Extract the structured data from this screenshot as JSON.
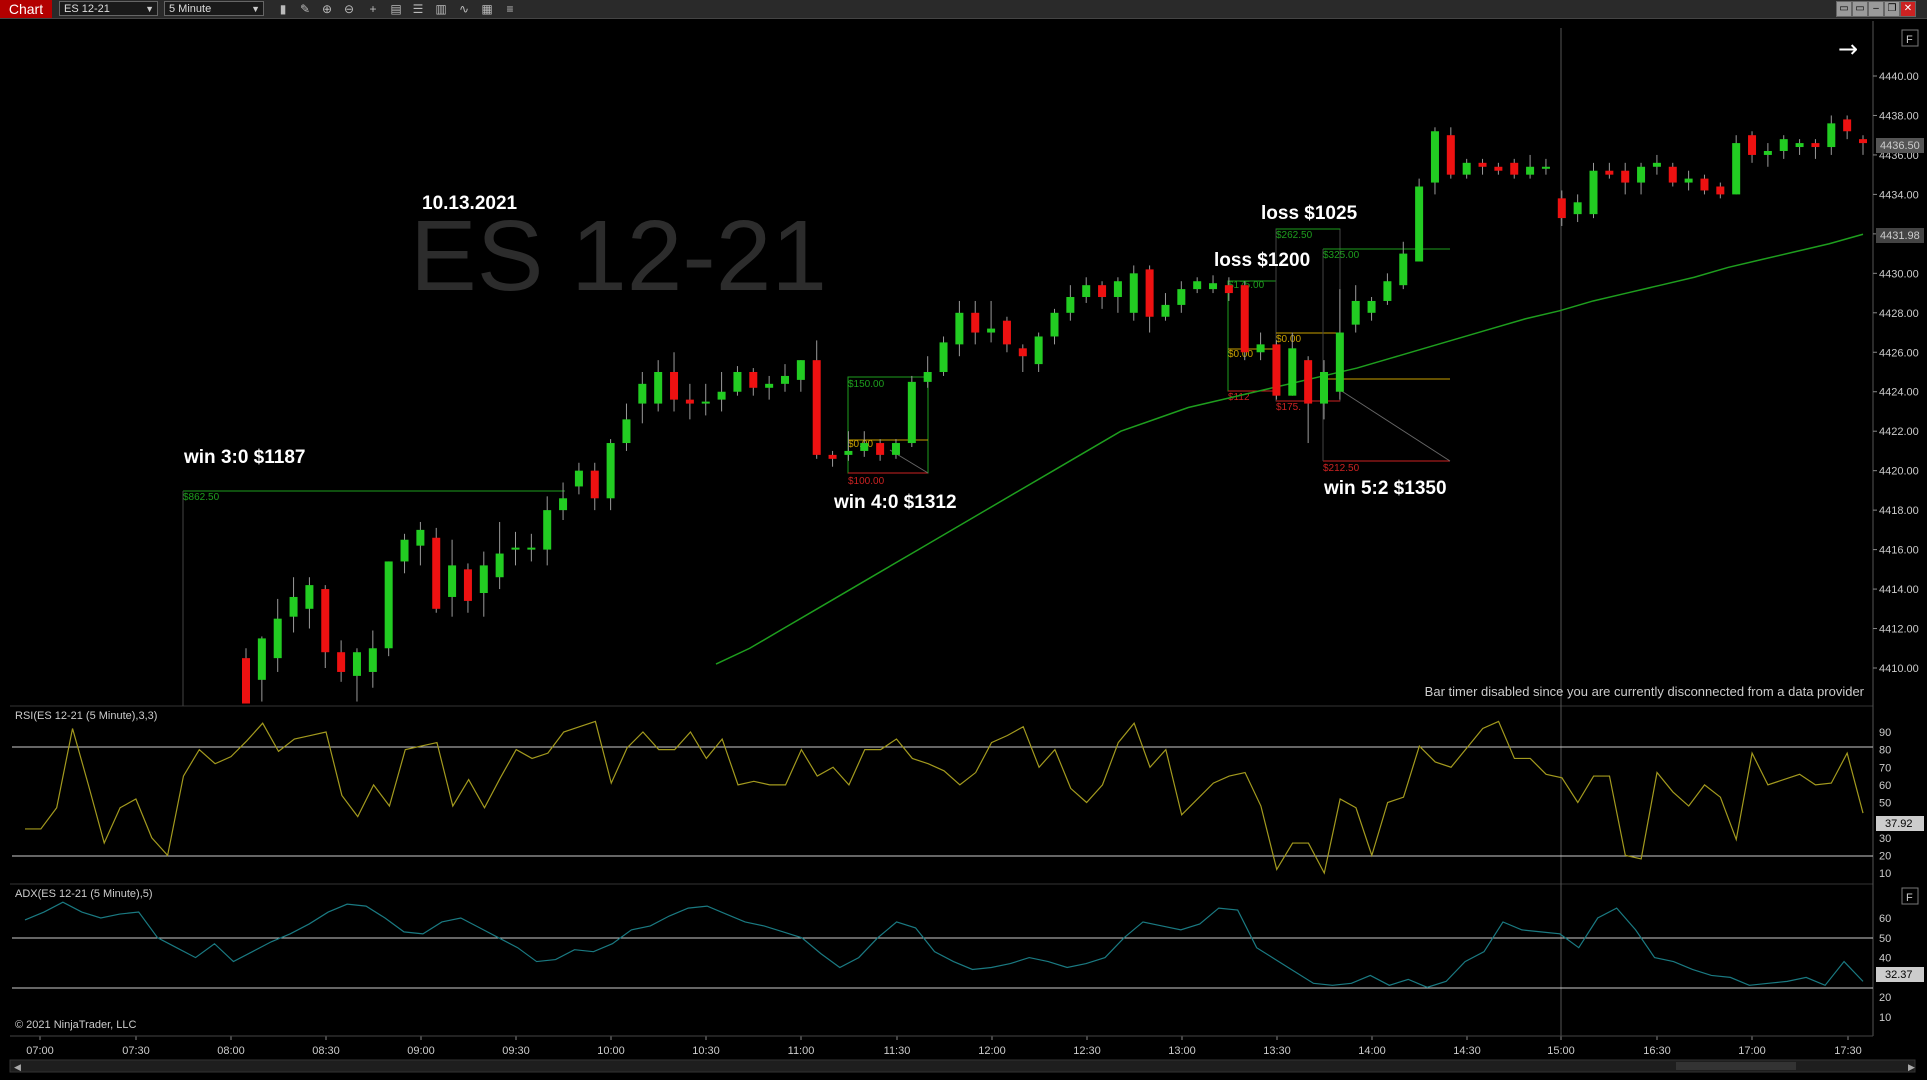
{
  "toolbar": {
    "chart_tab": "Chart",
    "instrument": "ES 12-21",
    "interval": "5 Minute",
    "tool_icons": [
      "bars-icon",
      "pencil-icon",
      "zoom-in-icon",
      "zoom-out-icon",
      "crosshair-icon",
      "properties-icon",
      "data-box-icon",
      "chart-style-icon",
      "indicators-icon",
      "strategies-icon",
      "list-icon"
    ],
    "window_buttons": [
      "tile-icon",
      "tile2-icon",
      "minimize-icon",
      "restore-icon",
      "close-icon"
    ]
  },
  "chart": {
    "watermark": "ES 12-21",
    "date": "10.13.2021",
    "bar_timer_msg": "Bar timer disabled since you are currently disconnected from a data provider",
    "copyright": "© 2021 NinjaTrader, LLC",
    "price_ticks": [
      "4440.00",
      "4438.00",
      "4436.00",
      "4434.00",
      "4432.00",
      "4430.00",
      "4428.00",
      "4426.00",
      "4424.00",
      "4422.00",
      "4420.00",
      "4418.00",
      "4416.00",
      "4414.00",
      "4412.00",
      "4410.00"
    ],
    "current_price": "4436.50",
    "ma_price": "4431.98",
    "time_ticks": [
      "07:00",
      "07:30",
      "08:00",
      "08:30",
      "09:00",
      "09:30",
      "10:00",
      "10:30",
      "11:00",
      "11:30",
      "12:00",
      "12:30",
      "13:00",
      "13:30",
      "14:00",
      "14:30",
      "15:00",
      "16:30",
      "17:00",
      "17:30"
    ],
    "annotations": [
      {
        "text": "win 3:0 $1187"
      },
      {
        "text": "win 4:0 $1312"
      },
      {
        "text": "loss $1200"
      },
      {
        "text": "loss $1025"
      },
      {
        "text": "win 5:2 $1350"
      }
    ],
    "trade_labels": [
      "$862.50",
      "$150.00",
      "$0.00",
      "$100.00",
      "$175.00",
      "$0.00",
      "$112",
      "$175.",
      "$262.50",
      "$325.00",
      "$0.00",
      "$212.50"
    ],
    "colors": {
      "up": "#22cc22",
      "down": "#ee1111",
      "ma": "#1e9e1e",
      "rsi": "#a39a1e",
      "adx": "#1a7a82"
    }
  },
  "rsi": {
    "title": "RSI(ES 12-21 (5 Minute),3,3)",
    "ticks": [
      "90",
      "80",
      "70",
      "60",
      "50",
      "40",
      "30",
      "20",
      "10"
    ],
    "value": "37.92"
  },
  "adx": {
    "title": "ADX(ES 12-21 (5 Minute),5)",
    "ticks": [
      "60",
      "50",
      "40",
      "30",
      "20",
      "10"
    ],
    "value": "32.37"
  },
  "chart_data": {
    "type": "candlestick",
    "instrument": "ES 12-21",
    "interval": "5 Minute",
    "ylim": [
      4409,
      4442
    ],
    "candles": [
      [
        4410.5,
        4408.2,
        4408.8,
        4411.0
      ],
      [
        4409.4,
        4411.5,
        4408.3,
        4411.6
      ],
      [
        4410.5,
        4412.5,
        4409.8,
        4413.5
      ],
      [
        4412.6,
        4413.6,
        4411.8,
        4414.6
      ],
      [
        4413.0,
        4414.2,
        4412.0,
        4414.6
      ],
      [
        4414.0,
        4410.8,
        4410.0,
        4414.2
      ],
      [
        4410.8,
        4409.8,
        4409.3,
        4411.4
      ],
      [
        4409.6,
        4410.8,
        4408.3,
        4411.0
      ],
      [
        4409.8,
        4411.0,
        4409.0,
        4411.9
      ],
      [
        4411.0,
        4415.4,
        4410.6,
        4415.4
      ],
      [
        4415.4,
        4416.5,
        4414.8,
        4416.8
      ],
      [
        4416.2,
        4417.0,
        4415.2,
        4417.4
      ],
      [
        4416.6,
        4413.0,
        4412.8,
        4417.1
      ],
      [
        4413.6,
        4415.2,
        4412.6,
        4416.5
      ],
      [
        4415.0,
        4413.4,
        4412.8,
        4415.3
      ],
      [
        4413.8,
        4415.2,
        4412.6,
        4415.9
      ],
      [
        4414.6,
        4415.8,
        4414.0,
        4417.4
      ],
      [
        4416.0,
        4416.1,
        4415.2,
        4416.9
      ],
      [
        4416.0,
        4416.1,
        4415.4,
        4416.8
      ],
      [
        4416.0,
        4418.0,
        4415.2,
        4418.7
      ],
      [
        4418.0,
        4418.6,
        4417.5,
        4419.4
      ],
      [
        4419.2,
        4420.0,
        4418.8,
        4420.4
      ],
      [
        4420.0,
        4418.6,
        4418.0,
        4420.4
      ],
      [
        4418.6,
        4421.4,
        4418.0,
        4421.6
      ],
      [
        4421.4,
        4422.6,
        4421.0,
        4423.4
      ],
      [
        4423.4,
        4424.4,
        4422.4,
        4425.0
      ],
      [
        4423.4,
        4425.0,
        4423.0,
        4425.6
      ],
      [
        4425.0,
        4423.6,
        4423.0,
        4426.0
      ],
      [
        4423.6,
        4423.4,
        4422.6,
        4424.4
      ],
      [
        4423.4,
        4423.5,
        4422.8,
        4424.4
      ],
      [
        4423.6,
        4424.0,
        4423.0,
        4425.0
      ],
      [
        4424.0,
        4425.0,
        4423.8,
        4425.3
      ],
      [
        4425.0,
        4424.2,
        4423.8,
        4425.2
      ],
      [
        4424.2,
        4424.4,
        4423.6,
        4424.8
      ],
      [
        4424.4,
        4424.8,
        4424.0,
        4425.4
      ],
      [
        4424.6,
        4425.6,
        4424.0,
        4425.6
      ],
      [
        4425.6,
        4420.8,
        4420.6,
        4426.6
      ],
      [
        4420.8,
        4420.6,
        4420.2,
        4421.0
      ],
      [
        4420.8,
        4421.0,
        4420.5,
        4422.0
      ],
      [
        4421.0,
        4421.4,
        4420.7,
        4422.0
      ],
      [
        4421.4,
        4420.8,
        4420.5,
        4421.6
      ],
      [
        4420.8,
        4421.4,
        4420.6,
        4421.6
      ],
      [
        4421.4,
        4424.5,
        4421.2,
        4424.8
      ],
      [
        4424.5,
        4425.0,
        4424.2,
        4425.8
      ],
      [
        4425.0,
        4426.5,
        4424.8,
        4426.8
      ],
      [
        4426.4,
        4428.0,
        4425.8,
        4428.6
      ],
      [
        4428.0,
        4427.0,
        4426.4,
        4428.6
      ],
      [
        4427.0,
        4427.2,
        4426.5,
        4428.6
      ],
      [
        4427.6,
        4426.4,
        4426.0,
        4427.8
      ],
      [
        4426.2,
        4425.8,
        4425.0,
        4426.4
      ],
      [
        4425.4,
        4426.8,
        4425.0,
        4427.0
      ],
      [
        4426.8,
        4428.0,
        4426.4,
        4428.2
      ],
      [
        4428.0,
        4428.8,
        4427.6,
        4429.4
      ],
      [
        4428.8,
        4429.4,
        4428.5,
        4429.8
      ],
      [
        4429.4,
        4428.8,
        4428.2,
        4429.6
      ],
      [
        4428.8,
        4429.6,
        4428.0,
        4429.8
      ],
      [
        4428.0,
        4430.0,
        4427.6,
        4430.4
      ],
      [
        4430.2,
        4427.8,
        4427.0,
        4430.4
      ],
      [
        4427.8,
        4428.4,
        4427.6,
        4429.0
      ],
      [
        4428.4,
        4429.2,
        4428.0,
        4429.6
      ],
      [
        4429.2,
        4429.6,
        4429.0,
        4429.8
      ],
      [
        4429.2,
        4429.5,
        4429.0,
        4429.9
      ],
      [
        4429.4,
        4429.0,
        4428.6,
        4429.8
      ],
      [
        4429.4,
        4426.0,
        4425.6,
        4429.6
      ],
      [
        4426.0,
        4426.4,
        4425.6,
        4427.0
      ],
      [
        4426.4,
        4423.8,
        4423.6,
        4426.6
      ],
      [
        4423.8,
        4426.2,
        4423.8,
        4427.0
      ],
      [
        4425.6,
        4423.4,
        4421.4,
        4425.8
      ],
      [
        4423.4,
        4425.0,
        4422.6,
        4425.6
      ],
      [
        4424.0,
        4427.0,
        4423.6,
        4429.2
      ],
      [
        4427.4,
        4428.6,
        4427.0,
        4429.4
      ],
      [
        4428.0,
        4428.6,
        4427.6,
        4428.8
      ],
      [
        4428.6,
        4429.6,
        4428.4,
        4430.0
      ],
      [
        4429.4,
        4431.0,
        4429.2,
        4431.6
      ],
      [
        4430.6,
        4434.4,
        4430.6,
        4434.8
      ],
      [
        4434.6,
        4437.2,
        4434.0,
        4437.4
      ],
      [
        4437.0,
        4435.0,
        4434.8,
        4437.4
      ],
      [
        4435.0,
        4435.6,
        4434.8,
        4435.8
      ],
      [
        4435.6,
        4435.4,
        4435.0,
        4435.8
      ],
      [
        4435.4,
        4435.2,
        4435.0,
        4435.6
      ],
      [
        4435.6,
        4435.0,
        4434.8,
        4435.8
      ],
      [
        4435.0,
        4435.4,
        4434.8,
        4436.0
      ],
      [
        4435.4,
        4435.4,
        4435.0,
        4435.8
      ],
      [
        4433.8,
        4432.8,
        4432.4,
        4434.2
      ],
      [
        4433.0,
        4433.6,
        4432.6,
        4434.0
      ],
      [
        4433.0,
        4435.2,
        4432.8,
        4435.6
      ],
      [
        4435.2,
        4435.0,
        4434.8,
        4435.6
      ],
      [
        4435.2,
        4434.6,
        4434.0,
        4435.6
      ],
      [
        4434.6,
        4435.4,
        4434.0,
        4435.6
      ],
      [
        4435.4,
        4435.6,
        4435.0,
        4436.0
      ],
      [
        4435.4,
        4434.6,
        4434.4,
        4435.6
      ],
      [
        4434.6,
        4434.8,
        4434.2,
        4435.2
      ],
      [
        4434.8,
        4434.2,
        4434.0,
        4435.0
      ],
      [
        4434.4,
        4434.0,
        4433.8,
        4434.6
      ],
      [
        4434.0,
        4436.6,
        4434.0,
        4437.0
      ],
      [
        4437.0,
        4436.0,
        4435.6,
        4437.2
      ],
      [
        4436.0,
        4436.2,
        4435.4,
        4436.6
      ],
      [
        4436.2,
        4436.8,
        4435.8,
        4437.0
      ],
      [
        4436.4,
        4436.6,
        4436.0,
        4436.8
      ],
      [
        4436.6,
        4436.4,
        4435.8,
        4436.8
      ],
      [
        4436.4,
        4437.6,
        4436.0,
        4438.0
      ],
      [
        4437.8,
        4437.2,
        4436.8,
        4438.0
      ],
      [
        4436.8,
        4436.6,
        4436.0,
        4437.0
      ]
    ],
    "moving_average": [
      4410.2,
      4411.0,
      4412.0,
      4413.0,
      4414.0,
      4415.0,
      4416.0,
      4417.0,
      4418.0,
      4419.0,
      4420.0,
      4421.0,
      4422.0,
      4422.6,
      4423.2,
      4423.6,
      4424.0,
      4424.4,
      4424.8,
      4425.2,
      4425.7,
      4426.2,
      4426.7,
      4427.2,
      4427.7,
      4428.1,
      4428.6,
      4429.0,
      4429.4,
      4429.8,
      4430.3,
      4430.7,
      4431.1,
      4431.5,
      4431.98
    ],
    "rsi": [
      35,
      35,
      47,
      92,
      60,
      27,
      47,
      52,
      30,
      20,
      65,
      80,
      72,
      76,
      85,
      95,
      79,
      86,
      88,
      90,
      54,
      42,
      60,
      48,
      80,
      82,
      84,
      48,
      63,
      47,
      64,
      80,
      75,
      78,
      90,
      93,
      96,
      61,
      81,
      90,
      80,
      80,
      90,
      75,
      86,
      60,
      62,
      60,
      60,
      80,
      65,
      70,
      60,
      80,
      80,
      86,
      75,
      72,
      68,
      60,
      67,
      84,
      88,
      93,
      70,
      80,
      58,
      50,
      60,
      84,
      95,
      70,
      80,
      43,
      52,
      61,
      65,
      67,
      48,
      12,
      27,
      27,
      10,
      52,
      47,
      20,
      50,
      53,
      82,
      73,
      70,
      81,
      92,
      96,
      75,
      75,
      66,
      64,
      50,
      65,
      65,
      20,
      18,
      67,
      56,
      48,
      60,
      53,
      29,
      78,
      60,
      63,
      66,
      60,
      61,
      78,
      44
    ],
    "adx": [
      59,
      63,
      68,
      63,
      60,
      62,
      63,
      50,
      45,
      40,
      47,
      38,
      43,
      48,
      52,
      57,
      63,
      67,
      66,
      60,
      53,
      52,
      58,
      60,
      55,
      50,
      45,
      38,
      39,
      44,
      43,
      47,
      54,
      56,
      61,
      65,
      66,
      62,
      58,
      56,
      53,
      50,
      42,
      35,
      40,
      50,
      58,
      55,
      43,
      38,
      34,
      35,
      37,
      40,
      38,
      35,
      37,
      40,
      50,
      58,
      56,
      54,
      57,
      65,
      64,
      45,
      39,
      33,
      27,
      26,
      27,
      31,
      26,
      29,
      25,
      28,
      38,
      43,
      58,
      54,
      53,
      52,
      45,
      60,
      65,
      54,
      40,
      38,
      34,
      31,
      30,
      26,
      27,
      28,
      30,
      26,
      38,
      28
    ]
  }
}
